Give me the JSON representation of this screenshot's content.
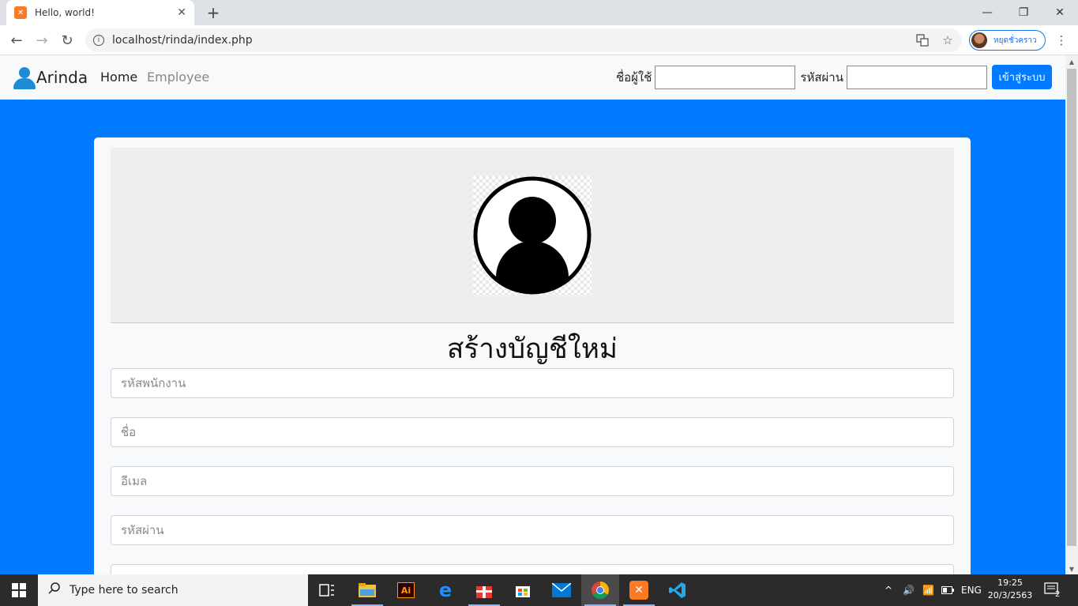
{
  "browser": {
    "tab_title": "Hello, world!",
    "url": "localhost/rinda/index.php",
    "profile_name": "หยุดชั่วคราว"
  },
  "navbar": {
    "brand": "Arinda",
    "links": [
      {
        "label": "Home",
        "active": true
      },
      {
        "label": "Employee",
        "active": false
      }
    ],
    "username_label": "ชื่อผู้ใช้",
    "password_label": "รหัสผ่าน",
    "username_value": "",
    "password_value": "",
    "login_button": "เข้าสู่ระบบ"
  },
  "form": {
    "title": "สร้างบัญชีใหม่",
    "fields": [
      {
        "placeholder": "รหัสพนักงาน"
      },
      {
        "placeholder": "ชื่อ"
      },
      {
        "placeholder": "อีเมล"
      },
      {
        "placeholder": "รหัสผ่าน"
      }
    ]
  },
  "taskbar": {
    "search_placeholder": "Type here to search",
    "language": "ENG",
    "time": "19:25",
    "date": "20/3/2563",
    "notifications": "2"
  },
  "colors": {
    "primary": "#007bff",
    "navbar_bg": "#f8f9fa",
    "card_bg": "#f8f9fa",
    "taskbar_bg": "#2b2b2b"
  }
}
